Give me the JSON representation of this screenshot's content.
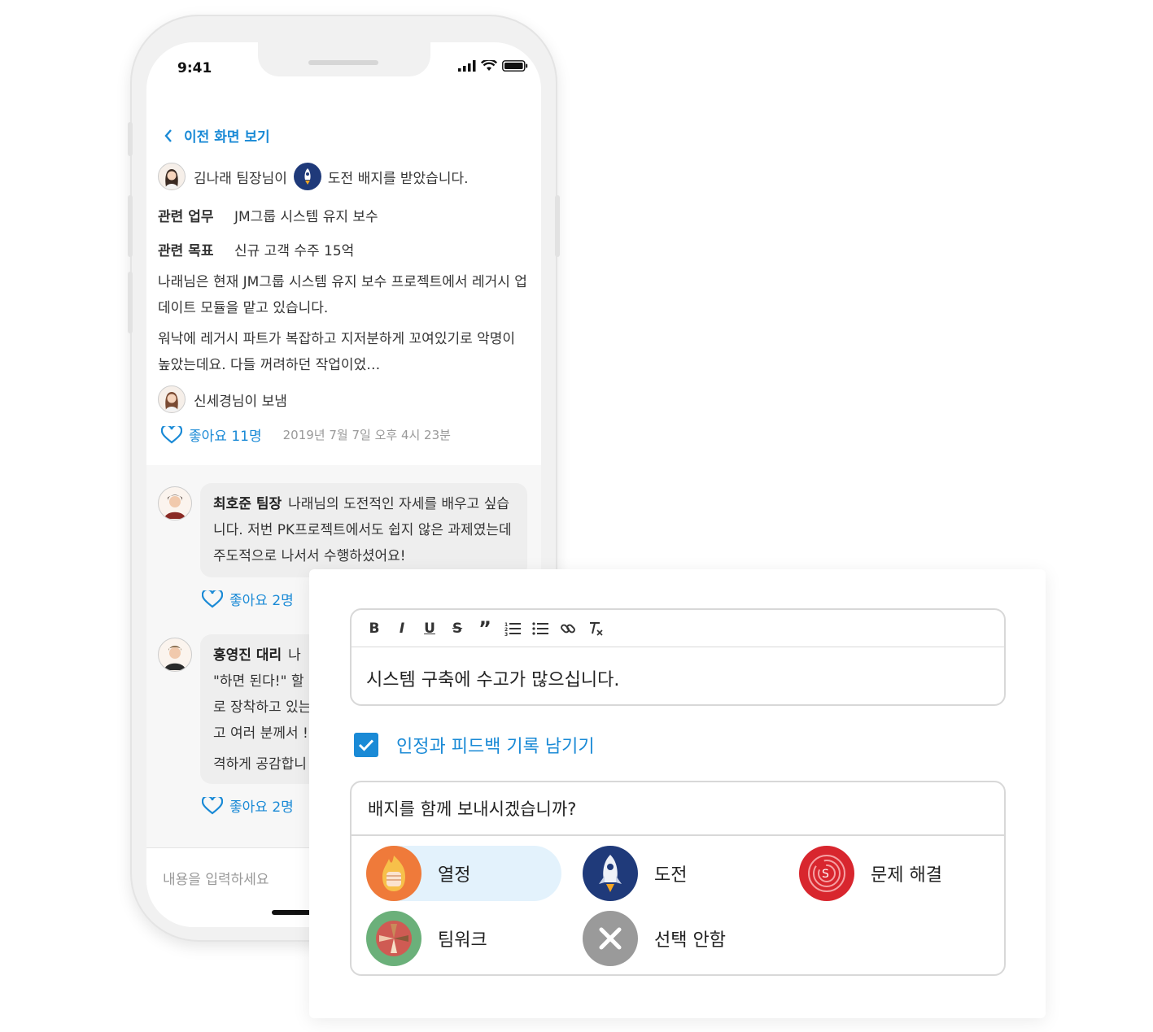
{
  "status_bar": {
    "time": "9:41"
  },
  "nav": {
    "back_label": "이전 화면 보기"
  },
  "post": {
    "receiver": "김나래 팀장님이",
    "badge_text": "도전 배지를 받았습니다.",
    "related_task_key": "관련 업무",
    "related_task_value": "JM그룹 시스템 유지 보수",
    "related_goal_key": "관련 목표",
    "related_goal_value": "신규 고객 수주 15억",
    "paragraph_1": "나래님은 현재 JM그룹 시스템 유지 보수 프로젝트에서 레거시 업데이트 모듈을 맡고 있습니다.",
    "paragraph_2": "워낙에 레거시 파트가 복잡하고 지저분하게 꼬여있기로 악명이 높았는데요. 다들 꺼려하던 작업이었…",
    "sender": "신세경님이 보냄",
    "likes": "좋아요 11명",
    "timestamp": "2019년 7월 7일 오후 4시 23분"
  },
  "comments": [
    {
      "author": "최호준 팀장",
      "text": "나래님의 도전적인 자세를 배우고 싶습니다. 저번 PK프로젝트에서도 쉽지 않은 과제였는데 주도적으로 나서서 수행하셨어요!",
      "likes": "좋아요 2명"
    },
    {
      "author": "홍영진 대리",
      "line_1": "나",
      "line_2": "\"하면 된다!\" 할",
      "line_3": "로 장착하고 있는",
      "line_4": "고 여러 분께서 !",
      "line_5": "격하게 공감합니",
      "likes": "좋아요 2명"
    }
  ],
  "comment_input": {
    "placeholder": "내용을 입력하세요"
  },
  "editor": {
    "toolbar": [
      "B",
      "I",
      "U",
      "S",
      "”",
      "ordered-list",
      "bullet-list",
      "link",
      "clear-format"
    ],
    "text": "시스템 구축에 수고가 많으십니다."
  },
  "record_option": {
    "label": "인정과 피드백 기록 남기기",
    "checked": true
  },
  "badge_picker": {
    "question": "배지를 함께 보내시겠습니까?",
    "badges": [
      {
        "label": "열정",
        "icon": "fire-fist-icon",
        "color": "#ef7a3a",
        "selected": true
      },
      {
        "label": "도전",
        "icon": "rocket-icon",
        "color": "#1f3a7a",
        "selected": false
      },
      {
        "label": "문제 해결",
        "icon": "maze-icon",
        "color": "#d8262e",
        "selected": false
      },
      {
        "label": "팀워크",
        "icon": "hands-icon",
        "color": "#6bb07a",
        "selected": false
      },
      {
        "label": "선택 안함",
        "icon": "close-icon",
        "color": "#9a9a9a",
        "selected": false
      }
    ]
  },
  "colors": {
    "accent": "#1a8ad6",
    "selected_bg": "#e3f2fc"
  }
}
